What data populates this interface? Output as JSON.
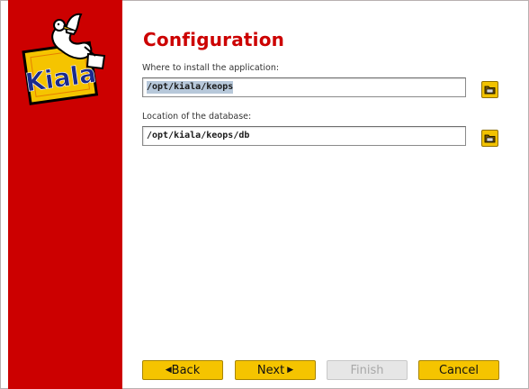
{
  "app": {
    "logo_text": "Kiala",
    "brand_color": "#cc0000",
    "accent_color": "#f5c400"
  },
  "page": {
    "title": "Configuration"
  },
  "fields": {
    "install_dir": {
      "label": "Where to install the application:",
      "value": "/opt/kiala/keops",
      "selected": true,
      "browse_icon": "folder-open-icon"
    },
    "db_location": {
      "label": "Location of the database:",
      "value": "/opt/kiala/keops/db",
      "selected": false,
      "browse_icon": "folder-open-icon"
    }
  },
  "buttons": {
    "back_label": "Back",
    "back_icon": "triangle-left-icon",
    "next_label": "Next",
    "next_icon": "triangle-right-icon",
    "finish_label": "Finish",
    "finish_enabled": false,
    "cancel_label": "Cancel"
  }
}
